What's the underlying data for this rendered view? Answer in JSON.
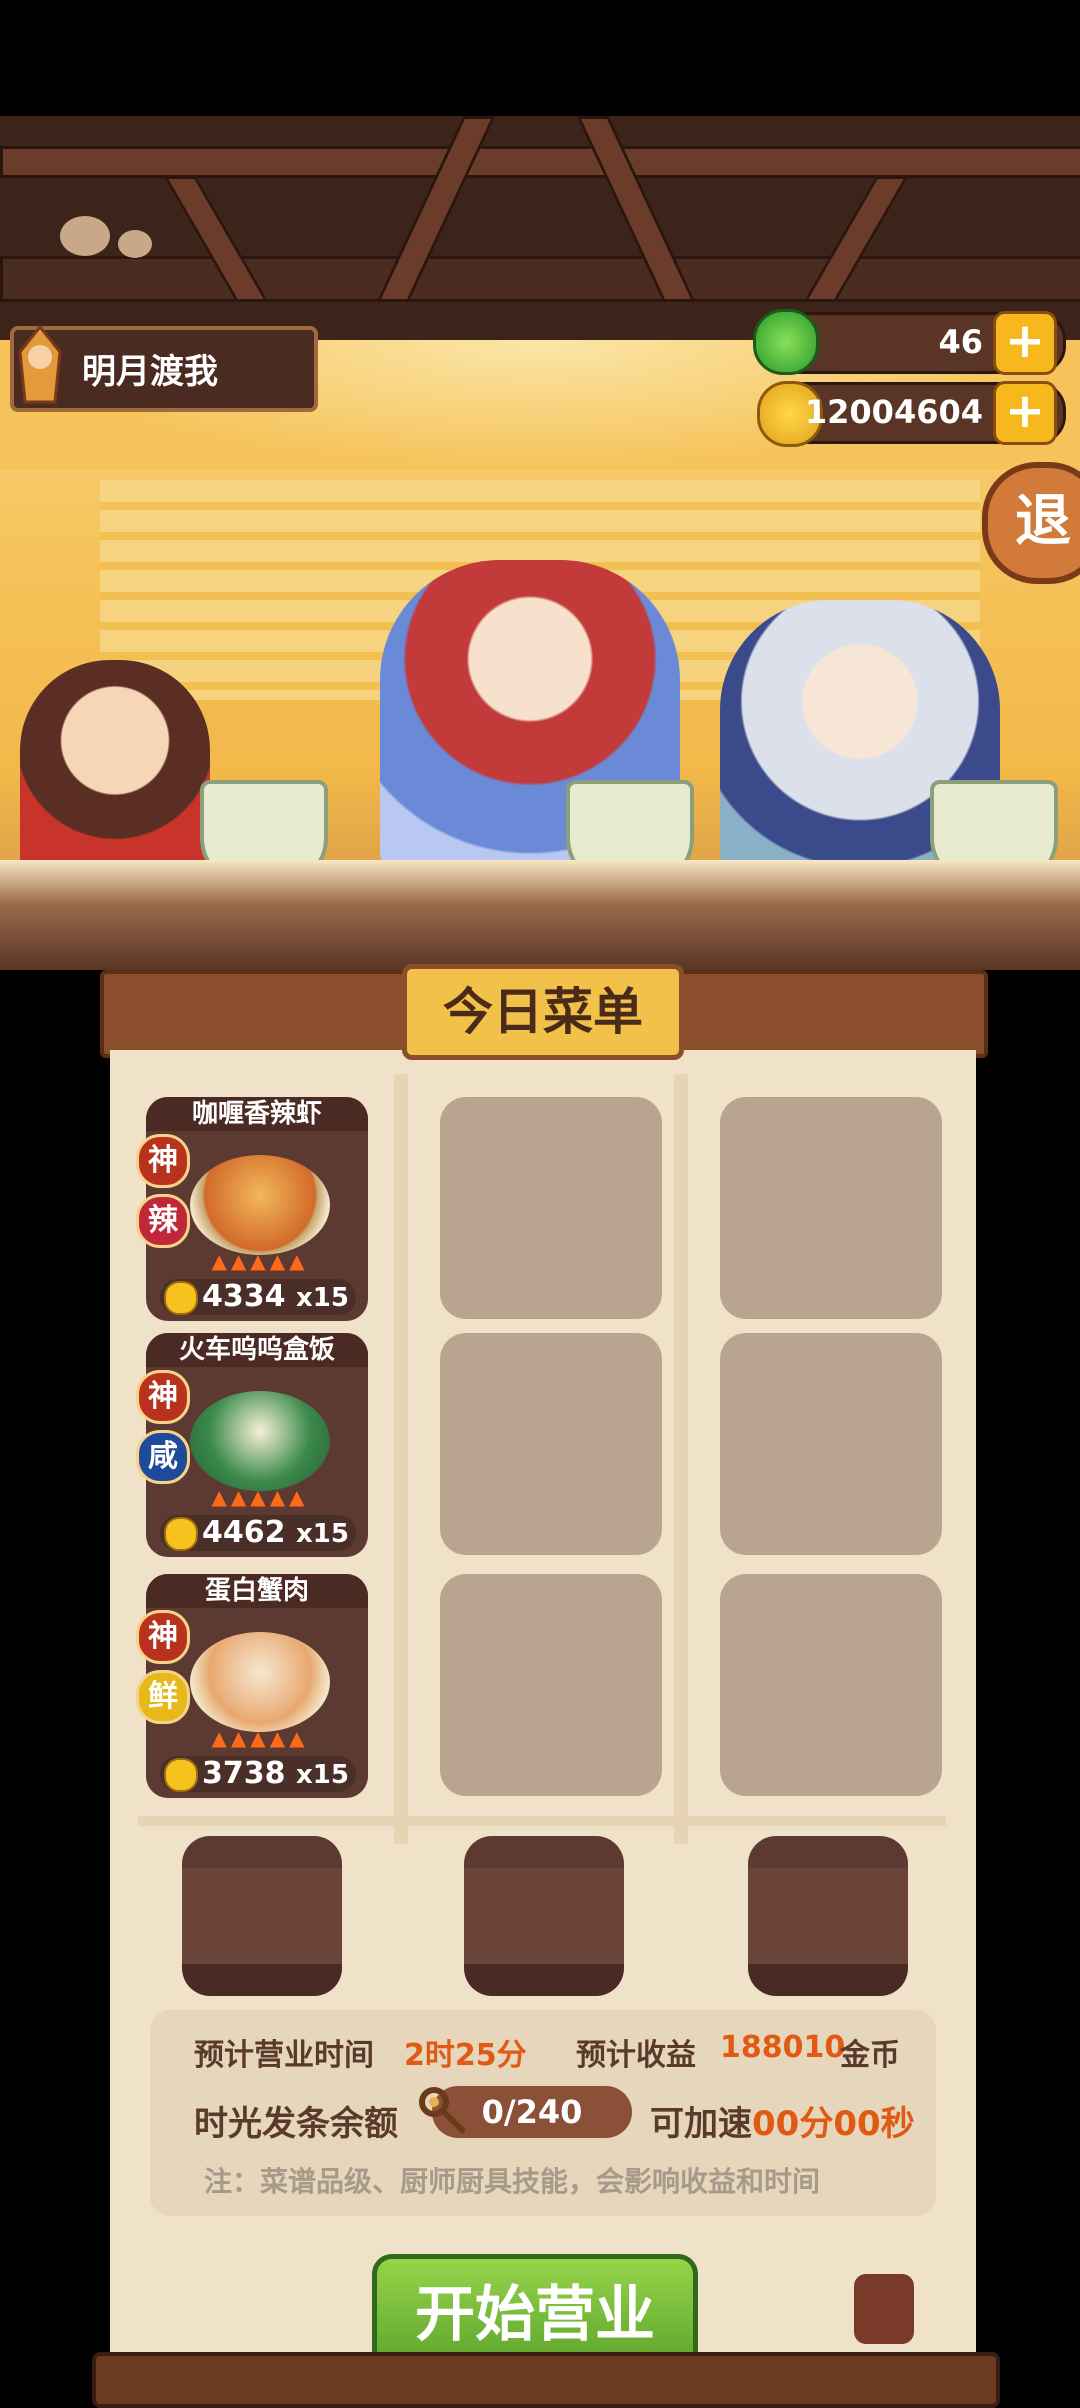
{
  "header": {
    "player_name": "明月渡我",
    "jade_count": "46",
    "coin_count": "12004604",
    "plus_glyph": "+",
    "exit_label": "退"
  },
  "menu": {
    "title": "今日菜单",
    "dishes": [
      {
        "name": "咖喱香辣虾",
        "grade": "神",
        "flavor": "辣",
        "flavor_color": "#c0283a",
        "price": "4334",
        "qty": "x15"
      },
      {
        "name": "火车呜呜盒饭",
        "grade": "神",
        "flavor": "咸",
        "flavor_color": "#1e4a9a",
        "price": "4462",
        "qty": "x15"
      },
      {
        "name": "蛋白蟹肉",
        "grade": "神",
        "flavor": "鲜",
        "flavor_color": "#e6b81a",
        "price": "3738",
        "qty": "x15"
      }
    ]
  },
  "info": {
    "time_label": "预计营业时间",
    "time_value": "2时25分",
    "income_label": "预计收益",
    "income_value": "188010",
    "income_unit": "金币",
    "voucher_label": "时光发条余额",
    "voucher_value": "0/240",
    "speedup_label": "可加速",
    "speedup_value": "00分00秒",
    "note": "注：菜谱品级、厨师厨具技能，会影响收益和时间"
  },
  "actions": {
    "start_label": "开始营业"
  },
  "icons": {
    "jade": "jade-icon",
    "coin": "coin-icon",
    "clockwork": "clockwork-key-icon",
    "flame": "flame-icon"
  }
}
